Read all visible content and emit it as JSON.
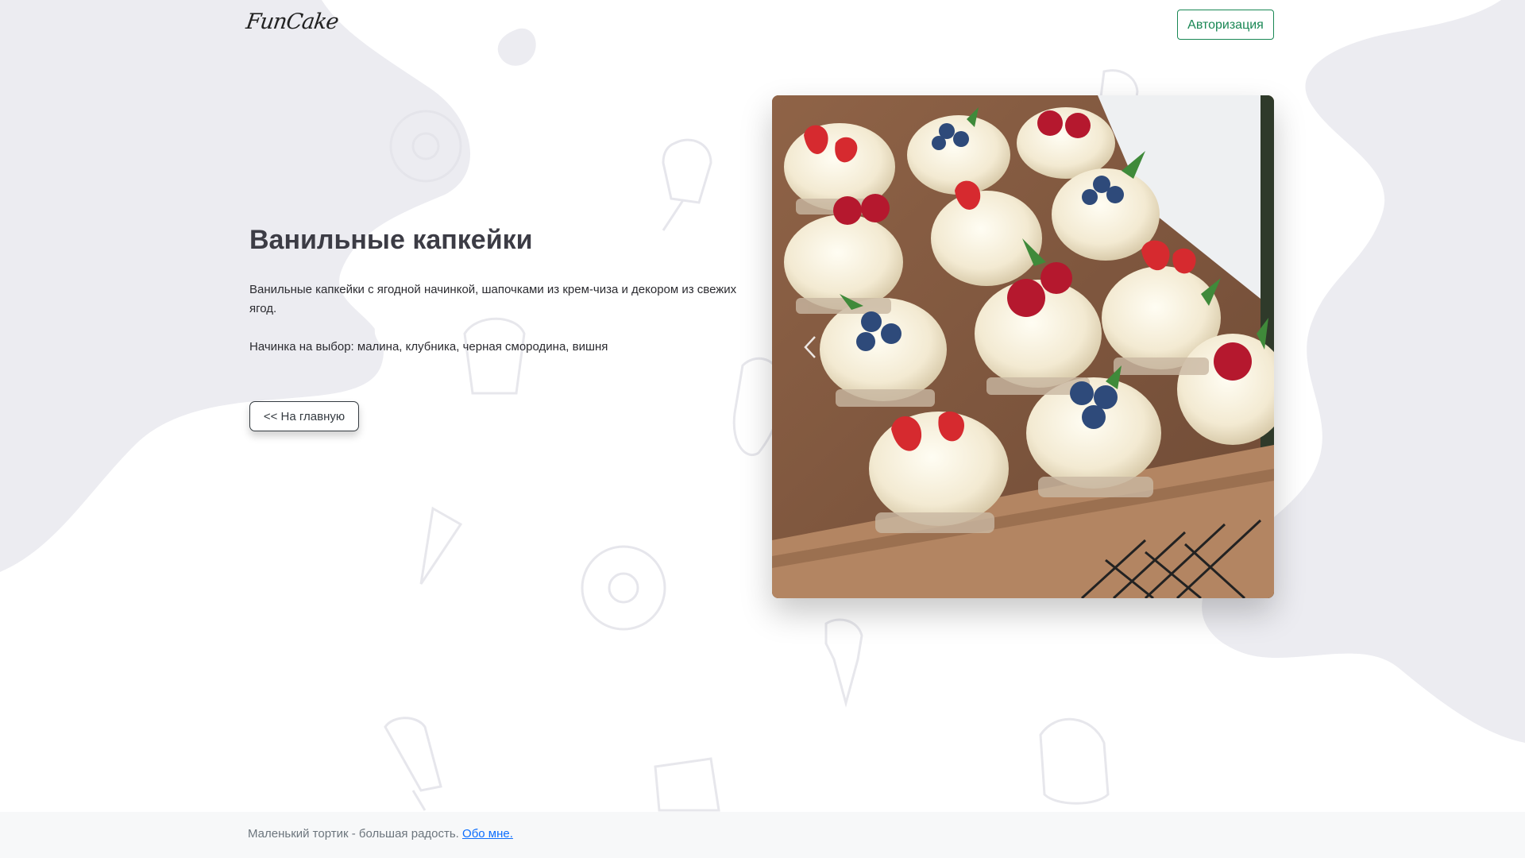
{
  "header": {
    "logo_text": "FunCake",
    "auth_button_label": "Авторизация"
  },
  "product": {
    "title": "Ванильные капкейки",
    "description": "Ванильные капкейки с ягодной начинкой, шапочками из крем-чиза и декором из свежих ягод.",
    "filling": "Начинка на выбор: малина, клубника, черная смородина, вишня"
  },
  "back_button_label": "<< На главную",
  "carousel": {
    "prev_icon": "chevron-left-icon",
    "image_subject": "cupcakes-photo"
  },
  "footer": {
    "text": "Маленький тортик - большая радость.",
    "link_label": "Обо мне."
  },
  "colors": {
    "accent_green": "#198754",
    "blob_gray": "#ececf1",
    "footer_bg": "#f7f8f9",
    "link_blue": "#0d6efd"
  }
}
